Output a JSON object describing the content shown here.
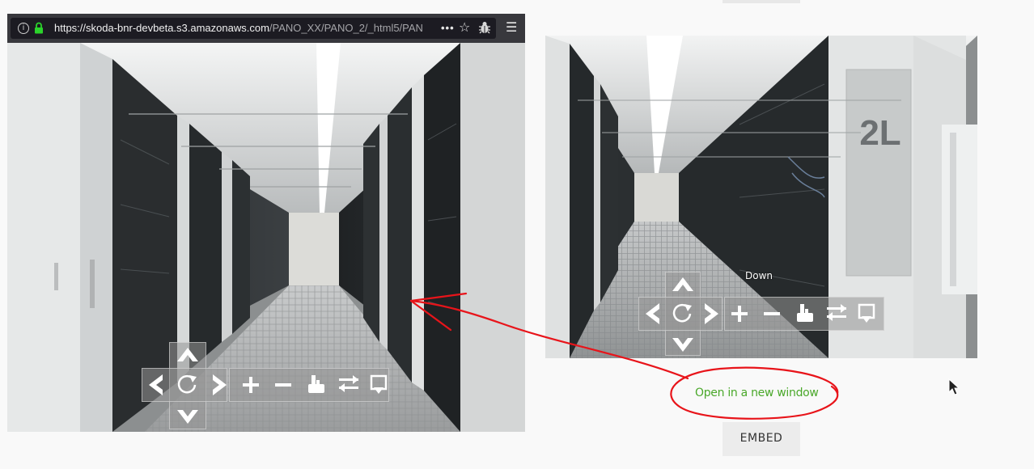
{
  "browser": {
    "url_host": "https://skoda-bnr-devbeta.s3.amazonaws.com",
    "url_path": "/PANO_XX/PANO_2/_html5/PAN",
    "more_label": "•••",
    "icons": [
      "info-icon",
      "lock-icon",
      "more-icon",
      "bookmark-star-icon",
      "bug-icon",
      "menu-icon"
    ]
  },
  "pano_controls": {
    "buttons": [
      "arrow-up",
      "arrow-left",
      "rotate",
      "arrow-right",
      "arrow-down",
      "zoom-in",
      "zoom-out",
      "hand-drag",
      "switch-mode",
      "fullscreen"
    ],
    "tooltip": "Down"
  },
  "page": {
    "open_link": "Open in a new window",
    "embed_label": "EMBED"
  },
  "colors": {
    "link": "#4aa82a",
    "annotation": "#e8141a",
    "url_bar": "#38383d"
  }
}
